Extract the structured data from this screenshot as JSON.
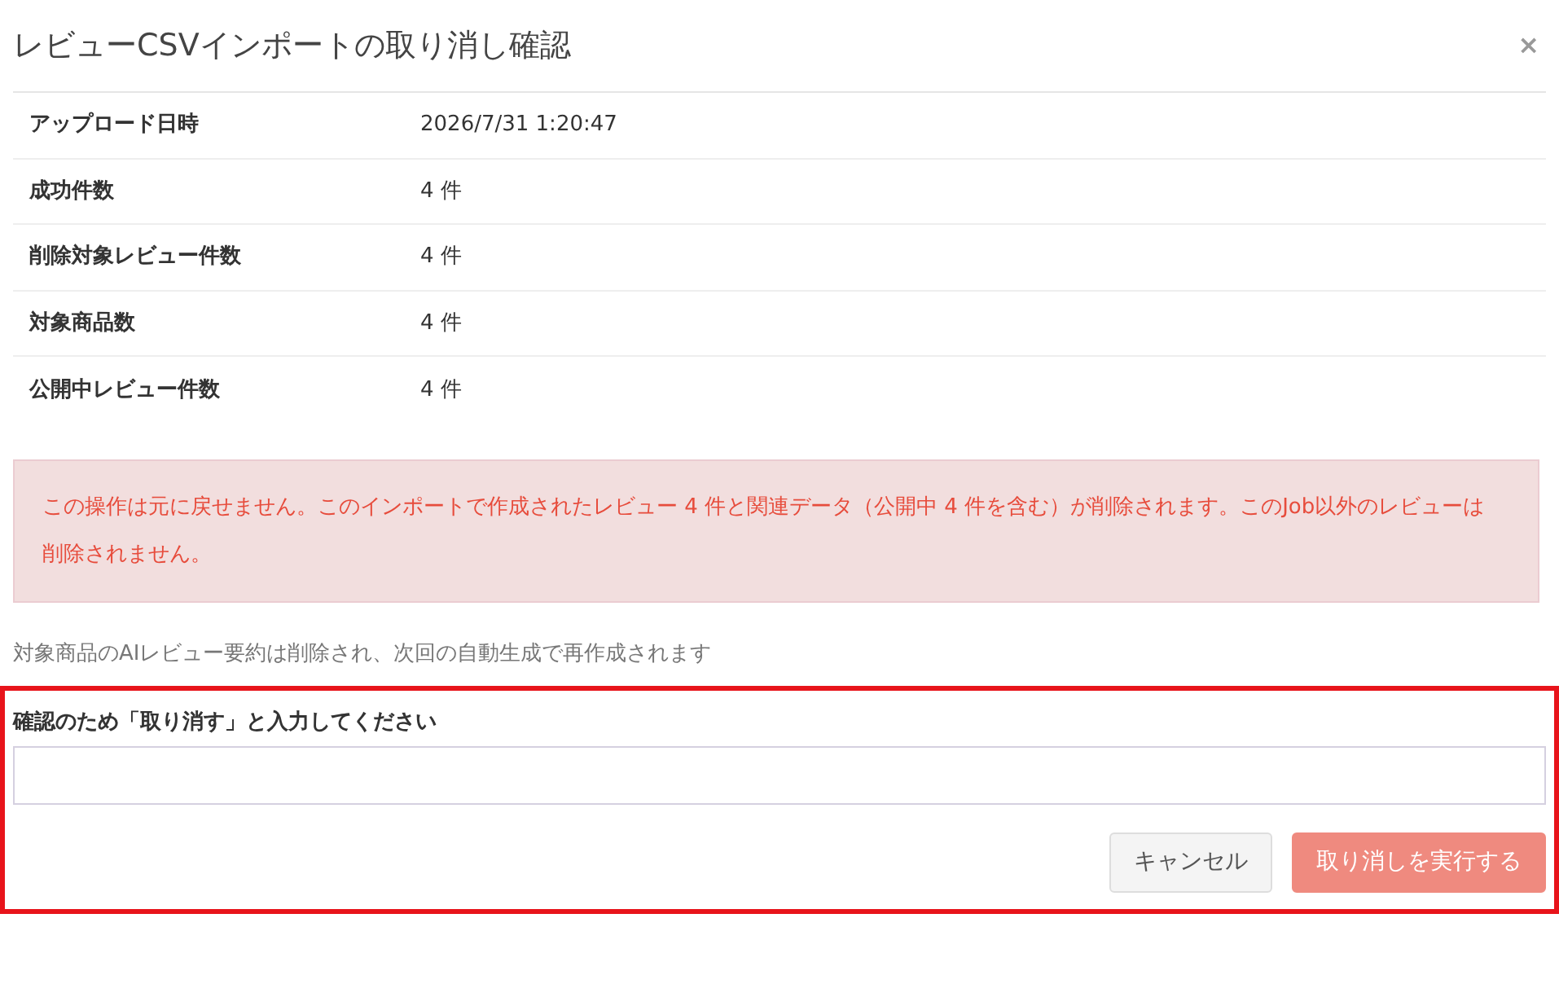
{
  "dialog": {
    "title": "レビューCSVインポートの取り消し確認",
    "close": "×"
  },
  "details": [
    {
      "label": "アップロード日時",
      "value": "2026/7/31 1:20:47"
    },
    {
      "label": "成功件数",
      "value": "4 件"
    },
    {
      "label": "削除対象レビュー件数",
      "value": "4 件"
    },
    {
      "label": "対象商品数",
      "value": "4 件"
    },
    {
      "label": "公開中レビュー件数",
      "value": "4 件"
    }
  ],
  "alert": {
    "text": "この操作は元に戻せません。このインポートで作成されたレビュー 4 件と関連データ（公開中 4 件を含む）が削除されます。このJob以外のレビューは削除されません。"
  },
  "note": "対象商品のAIレビュー要約は削除され、次回の自動生成で再作成されます",
  "confirm": {
    "label": "確認のため「取り消す」と入力してください"
  },
  "buttons": [
    {
      "label": "キャンセル",
      "kind": "secondary",
      "disabled": false
    },
    {
      "label": "取り消しを実行する",
      "kind": "danger",
      "disabled": true
    }
  ]
}
